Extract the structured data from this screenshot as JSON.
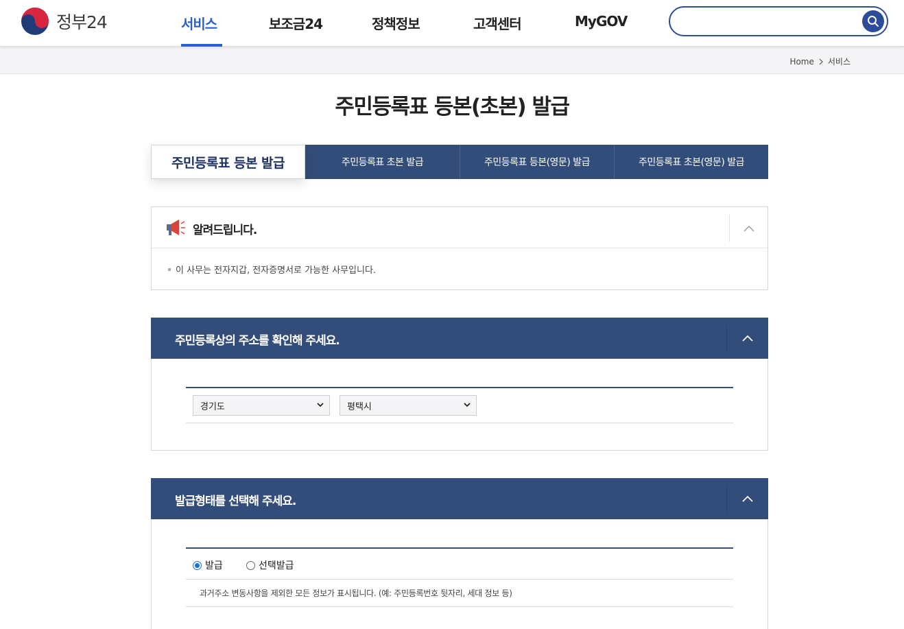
{
  "header": {
    "logo_text": "정부24",
    "nav": [
      "서비스",
      "보조금24",
      "정책정보",
      "고객센터",
      "MyGOV"
    ],
    "active_nav": "서비스",
    "search_placeholder": ""
  },
  "breadcrumb": [
    "Home",
    "서비스"
  ],
  "page_title": "주민등록표 등본(초본) 발급",
  "tabs": [
    {
      "label": "주민등록표 등본 발급",
      "active": true
    },
    {
      "label": "주민등록표 초본 발급",
      "active": false
    },
    {
      "label": "주민등록표 등본(영문) 발급",
      "active": false
    },
    {
      "label": "주민등록표 초본(영문) 발급",
      "active": false
    }
  ],
  "notice": {
    "title": "알려드립니다.",
    "items": [
      "이 사무는 전자지갑, 전자증명서로 가능한 사무입니다."
    ]
  },
  "address_section": {
    "title": "주민등록상의 주소를 확인해 주세요.",
    "province": "경기도",
    "city": "평택시"
  },
  "issue_section": {
    "title": "발급형태를 선택해 주세요.",
    "options": [
      {
        "label": "발급",
        "checked": true
      },
      {
        "label": "선택발급",
        "checked": false
      }
    ],
    "description": "과거주소 변동사항을 제외한 모든 정보가 표시됩니다. (예: 주민등록번호 뒷자리, 세대 정보 등)"
  },
  "colors": {
    "brand_blue": "#2a60c9",
    "section_navy": "#334d7a",
    "search_border": "#2b4c98"
  },
  "icons": [
    "taegeuk-logo-icon",
    "search-icon",
    "megaphone-icon",
    "chevron-up-icon",
    "chevron-right-icon",
    "chevron-down-icon"
  ]
}
